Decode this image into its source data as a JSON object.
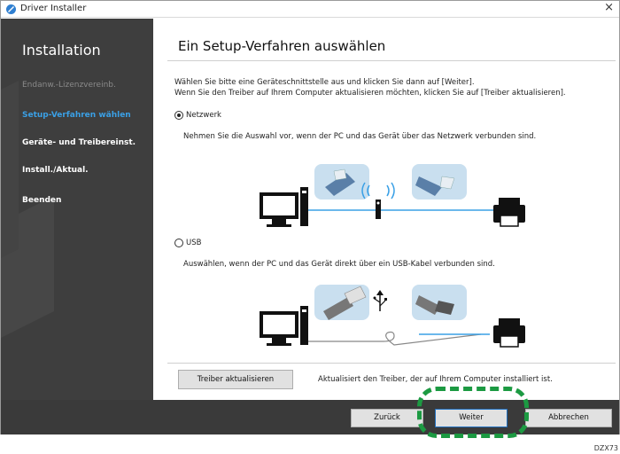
{
  "window": {
    "title": "Driver Installer",
    "close_glyph": "×"
  },
  "sidebar": {
    "title": "Installation",
    "items": [
      {
        "label": "Endanw.-Lizenzvereinb.",
        "state": "done"
      },
      {
        "label": "Setup-Verfahren wählen",
        "state": "active"
      },
      {
        "label": "Geräte- und Treibereinst.",
        "state": "pending"
      },
      {
        "label": "Install./Aktual.",
        "state": "pending"
      },
      {
        "label": "Beenden",
        "state": "pending"
      }
    ]
  },
  "main": {
    "title": "Ein Setup-Verfahren auswählen",
    "intro_line1": "Wählen Sie bitte eine Geräteschnittstelle aus und klicken Sie dann auf [Weiter].",
    "intro_line2": "Wenn Sie den Treiber auf Ihrem Computer aktualisieren möchten, klicken Sie auf [Treiber aktualisieren].",
    "options": [
      {
        "label": "Netzwerk",
        "selected": true,
        "description": "Nehmen Sie die Auswahl vor, wenn der PC und das Gerät über das Netzwerk verbunden sind."
      },
      {
        "label": "USB",
        "selected": false,
        "description": "Auswählen, wenn der PC und das Gerät direkt über ein USB-Kabel verbunden sind."
      }
    ],
    "update_button": "Treiber aktualisieren",
    "update_description": "Aktualisiert den Treiber, der auf Ihrem Computer installiert ist."
  },
  "footer": {
    "back": "Zurück",
    "next": "Weiter",
    "cancel": "Abbrechen"
  },
  "figure_code": "DZX73",
  "colors": {
    "sidebar_bg": "#3e3e3e",
    "active_step": "#3aa0e6",
    "highlight": "#1c9a42",
    "cable_blue": "#3aa0e6"
  }
}
